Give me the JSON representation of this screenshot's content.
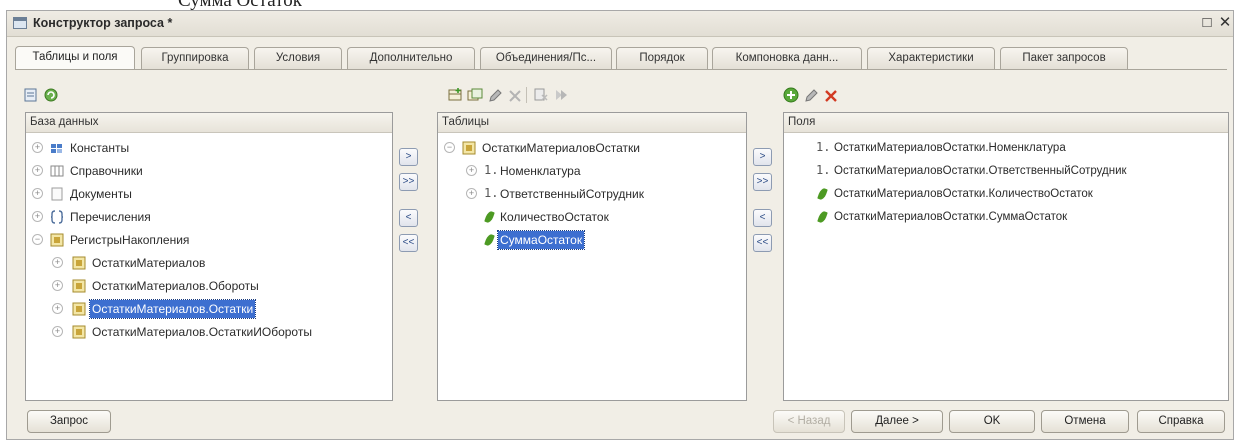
{
  "window": {
    "title": "Конструктор запроса *",
    "close": "✕",
    "maximize": "□"
  },
  "top_fragment": "Сумма Остаток",
  "tabs": [
    "Таблицы и поля",
    "Группировка",
    "Условия",
    "Дополнительно",
    "Объединения/Пс...",
    "Порядок",
    "Компоновка данн...",
    "Характеристики",
    "Пакет запросов"
  ],
  "database": {
    "header": "База данных",
    "items": [
      "Константы",
      "Справочники",
      "Документы",
      "Перечисления",
      "РегистрыНакопления",
      "ОстаткиМатериалов",
      "ОстаткиМатериалов.Обороты",
      "ОстаткиМатериалов.Остатки",
      "ОстаткиМатериалов.ОстаткиИОбороты"
    ]
  },
  "tables": {
    "header": "Таблицы",
    "items": [
      "ОстаткиМатериаловОстатки",
      "Номенклатура",
      "ОтветственныйСотрудник",
      "КоличествоОстаток",
      "СуммаОстаток"
    ]
  },
  "fields": {
    "header": "Поля",
    "items": [
      "ОстаткиМатериаловОстатки.Номенклатура",
      "ОстаткиМатериаловОстатки.ОтветственныйСотрудник",
      "ОстаткиМатериаловОстатки.КоличествоОстаток",
      "ОстаткиМатериаловОстатки.СуммаОстаток"
    ]
  },
  "move_buttons": [
    ">",
    ">>",
    "<",
    "<<"
  ],
  "buttons": {
    "query": "Запрос",
    "back": "< Назад",
    "next": "Далее >",
    "ok": "OK",
    "cancel": "Отмена",
    "help": "Справка"
  },
  "colors": {
    "selection": "#3d6fd0",
    "window_bg": "#f1eee6",
    "accent_green": "#4d9a23",
    "delete_red": "#d23a22"
  }
}
